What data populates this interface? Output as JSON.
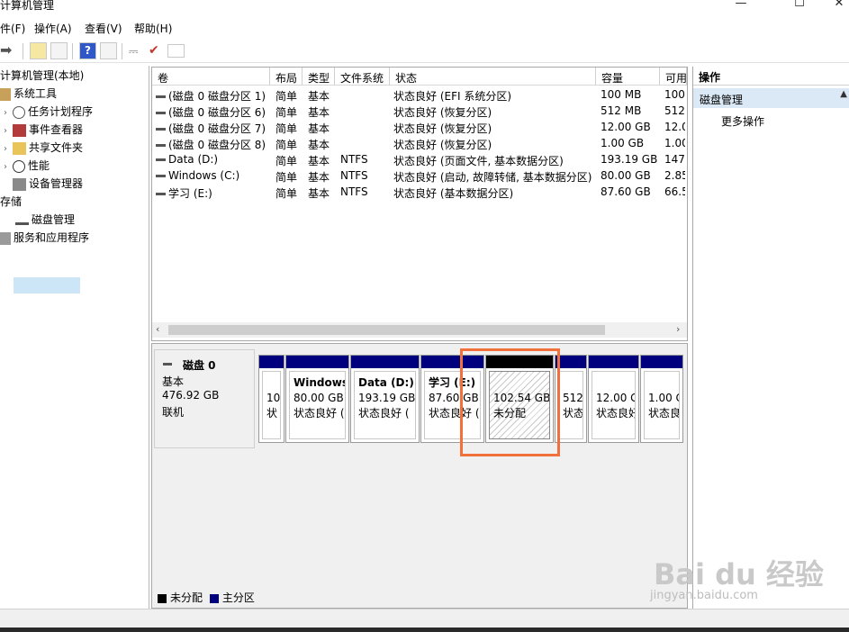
{
  "window": {
    "title": "计算机管理",
    "minimize": "—",
    "maximize": "☐",
    "close": "✕"
  },
  "menu": [
    "件(F)",
    "操作(A)",
    "查看(V)",
    "帮助(H)"
  ],
  "tree": {
    "root": "计算机管理(本地)",
    "system_tools": "系统工具",
    "task_scheduler": "任务计划程序",
    "event_viewer": "事件查看器",
    "shared_folders": "共享文件夹",
    "performance": "性能",
    "device_manager": "设备管理器",
    "storage": "存储",
    "disk_management": "磁盘管理",
    "services": "服务和应用程序"
  },
  "volumes": {
    "headers": [
      "卷",
      "布局",
      "类型",
      "文件系统",
      "状态",
      "容量",
      "可用"
    ],
    "rows": [
      [
        "(磁盘 0 磁盘分区 1)",
        "简单",
        "基本",
        "",
        "状态良好 (EFI 系统分区)",
        "100 MB",
        "100"
      ],
      [
        "(磁盘 0 磁盘分区 6)",
        "简单",
        "基本",
        "",
        "状态良好 (恢复分区)",
        "512 MB",
        "512"
      ],
      [
        "(磁盘 0 磁盘分区 7)",
        "简单",
        "基本",
        "",
        "状态良好 (恢复分区)",
        "12.00 GB",
        "12.0"
      ],
      [
        "(磁盘 0 磁盘分区 8)",
        "简单",
        "基本",
        "",
        "状态良好 (恢复分区)",
        "1.00 GB",
        "1.00"
      ],
      [
        "Data (D:)",
        "简单",
        "基本",
        "NTFS",
        "状态良好 (页面文件, 基本数据分区)",
        "193.19 GB",
        "147."
      ],
      [
        "Windows (C:)",
        "简单",
        "基本",
        "NTFS",
        "状态良好 (启动, 故障转储, 基本数据分区)",
        "80.00 GB",
        "2.85"
      ],
      [
        "学习 (E:)",
        "简单",
        "基本",
        "NTFS",
        "状态良好 (基本数据分区)",
        "87.60 GB",
        "66.5"
      ]
    ]
  },
  "disk": {
    "name": "磁盘 0",
    "type": "基本",
    "size": "476.92 GB",
    "status": "联机",
    "partitions": [
      {
        "name": "",
        "size": "10",
        "status": "状",
        "unallocated": false
      },
      {
        "name": "Windows",
        "size": "80.00 GB",
        "status": "状态良好 (",
        "unallocated": false
      },
      {
        "name": "Data  (D:)",
        "size": "193.19 GB",
        "status": "状态良好 (",
        "unallocated": false
      },
      {
        "name": "学习  (E:)",
        "size": "87.60 GB",
        "status": "状态良好 (",
        "unallocated": false
      },
      {
        "name": "",
        "size": "102.54 GB",
        "status": "未分配",
        "unallocated": true
      },
      {
        "name": "",
        "size": "512",
        "status": "状态",
        "unallocated": false
      },
      {
        "name": "",
        "size": "12.00 G",
        "status": "状态良好",
        "unallocated": false
      },
      {
        "name": "",
        "size": "1.00 G",
        "status": "状态良",
        "unallocated": false
      }
    ]
  },
  "legend": {
    "unallocated": "未分配",
    "primary": "主分区"
  },
  "actions": {
    "header": "操作",
    "section": "磁盘管理",
    "more": "更多操作"
  },
  "watermark": {
    "logo": "Bai du 经验",
    "url": "jingyan.baidu.com"
  },
  "colors": {
    "primary_partition": "#00007f",
    "unallocated": "#000000",
    "highlight_box": "#f2703c",
    "selection": "#cde6f7"
  }
}
